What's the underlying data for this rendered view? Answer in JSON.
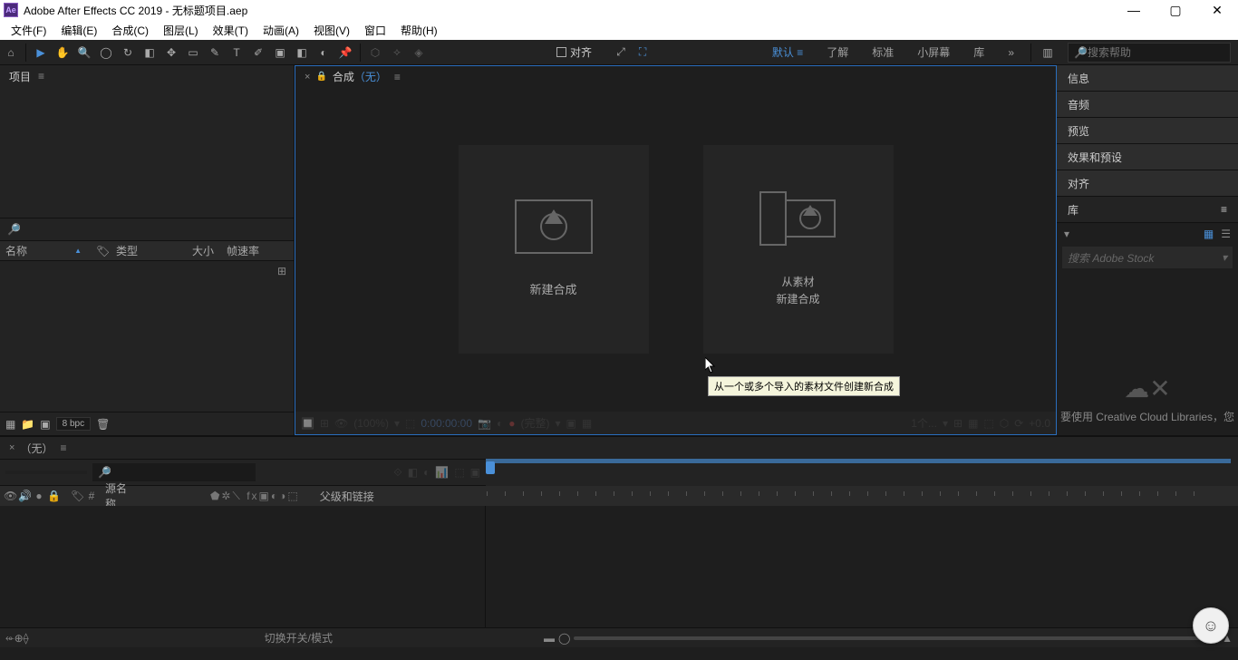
{
  "titlebar": {
    "app": "Adobe After Effects CC 2019",
    "file": "无标题项目.aep"
  },
  "menu": {
    "file": "文件(F)",
    "edit": "编辑(E)",
    "comp": "合成(C)",
    "layer": "图层(L)",
    "effect": "效果(T)",
    "anim": "动画(A)",
    "view": "视图(V)",
    "window": "窗口",
    "help": "帮助(H)"
  },
  "toolbar": {
    "snap": "对齐",
    "search_ph": "搜索帮助"
  },
  "workspaces": {
    "default": "默认",
    "learn": "了解",
    "standard": "标准",
    "small": "小屏幕",
    "library": "库"
  },
  "project": {
    "title": "项目",
    "cols": {
      "name": "名称",
      "type": "类型",
      "size": "大小",
      "fps": "帧速率"
    },
    "bpc": "8 bpc"
  },
  "comp": {
    "label": "合成",
    "none": "（无）",
    "new_comp": "新建合成",
    "from_footage_l1": "从素材",
    "from_footage_l2": "新建合成",
    "tooltip": "从一个或多个导入的素材文件创建新合成",
    "footer": {
      "zoom": "(100%)",
      "time": "0:00:00:00",
      "full": "(完整)",
      "cam": "1个...",
      "exp": "+0.0"
    }
  },
  "right": {
    "info": "信息",
    "audio": "音频",
    "preview": "预览",
    "effects": "效果和预设",
    "align": "对齐",
    "library": "库",
    "lib_search": "搜索 Adobe Stock",
    "lib_msg": "要使用 Creative Cloud Libraries，您"
  },
  "timeline": {
    "none": "（无）",
    "cols": {
      "src": "源名称",
      "parent": "父级和链接"
    },
    "switches": "切换开关/模式"
  }
}
